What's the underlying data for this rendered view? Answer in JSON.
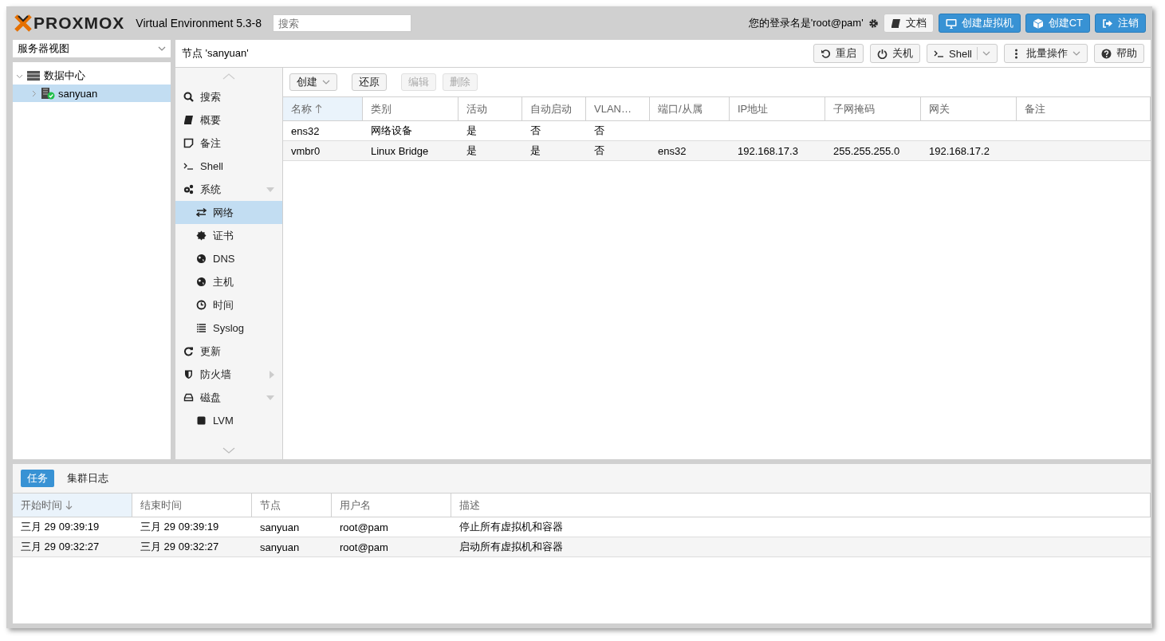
{
  "header": {
    "logo": "PROXMOX",
    "product": "Virtual Environment 5.3-8",
    "search": {
      "placeholder": "搜索"
    },
    "login": "您的登录名是'root@pam'",
    "buttons": [
      {
        "kind": "docs",
        "label": "文档",
        "primary": false
      },
      {
        "kind": "vm",
        "label": "创建虚拟机",
        "primary": true
      },
      {
        "kind": "ct",
        "label": "创建CT",
        "primary": true
      },
      {
        "kind": "logout",
        "label": "注销",
        "primary": true
      }
    ]
  },
  "sidebar": {
    "view": "服务器视图",
    "tree": [
      {
        "label": "数据中心",
        "kind": "datacenter",
        "expanded": true,
        "selected": false,
        "children": [
          {
            "label": "sanyuan",
            "kind": "node",
            "expanded": false,
            "selected": true
          }
        ]
      }
    ]
  },
  "panel": {
    "title": "节点 'sanyuan'",
    "buttons": [
      {
        "kind": "reload",
        "label": "重启",
        "menu": false
      },
      {
        "kind": "power",
        "label": "关机",
        "menu": false
      },
      {
        "kind": "shell",
        "label": "Shell",
        "menu": true
      },
      {
        "kind": "bulk",
        "label": "批量操作",
        "menu": true
      },
      {
        "kind": "help",
        "label": "帮助",
        "menu": false
      }
    ]
  },
  "nav": [
    {
      "kind": "search",
      "label": "搜索",
      "selected": false
    },
    {
      "kind": "summary",
      "label": "概要",
      "selected": false
    },
    {
      "kind": "notes",
      "label": "备注",
      "selected": false
    },
    {
      "kind": "shell",
      "label": "Shell",
      "selected": false
    },
    {
      "kind": "system",
      "label": "系统",
      "selected": false,
      "expanded": true,
      "children": [
        {
          "kind": "network",
          "label": "网络",
          "selected": true
        },
        {
          "kind": "cert",
          "label": "证书",
          "selected": false
        },
        {
          "kind": "globe",
          "label": "DNS",
          "selected": false
        },
        {
          "kind": "globe",
          "label": "主机",
          "selected": false
        },
        {
          "kind": "time",
          "label": "时间",
          "selected": false
        },
        {
          "kind": "list",
          "label": "Syslog",
          "selected": false
        }
      ]
    },
    {
      "kind": "updates",
      "label": "更新",
      "selected": false
    },
    {
      "kind": "firewall",
      "label": "防火墙",
      "selected": false,
      "expanded": false
    },
    {
      "kind": "disks",
      "label": "磁盘",
      "selected": false,
      "expanded": true,
      "children": [
        {
          "kind": "lvm",
          "label": "LVM",
          "selected": false
        }
      ]
    }
  ],
  "toolbar": [
    {
      "label": "创建",
      "menu": true,
      "disabled": false
    },
    {
      "label": "还原",
      "menu": false,
      "disabled": false
    },
    {
      "label": "编辑",
      "menu": false,
      "disabled": true
    },
    {
      "label": "删除",
      "menu": false,
      "disabled": true
    }
  ],
  "table": {
    "columns": [
      {
        "label": "名称",
        "sorted": true,
        "descending": false
      },
      {
        "label": "类别",
        "sorted": false
      },
      {
        "label": "活动",
        "sorted": false
      },
      {
        "label": "自动启动",
        "sorted": false
      },
      {
        "label": "VLAN…",
        "sorted": false
      },
      {
        "label": "端口/从属",
        "sorted": false
      },
      {
        "label": "IP地址",
        "sorted": false
      },
      {
        "label": "子网掩码",
        "sorted": false
      },
      {
        "label": "网关",
        "sorted": false
      },
      {
        "label": "备注",
        "sorted": false
      }
    ],
    "rows": [
      [
        "ens32",
        "网络设备",
        "是",
        "否",
        "否",
        "",
        "",
        "",
        "",
        ""
      ],
      [
        "vmbr0",
        "Linux Bridge",
        "是",
        "是",
        "否",
        "ens32",
        "192.168.17.3",
        "255.255.255.0",
        "192.168.17.2",
        ""
      ]
    ]
  },
  "log": {
    "tabs": [
      {
        "label": "任务",
        "selected": true
      },
      {
        "label": "集群日志",
        "selected": false
      }
    ],
    "columns": [
      {
        "label": "开始时间",
        "sorted": true,
        "descending": true
      },
      {
        "label": "结束时间",
        "sorted": false
      },
      {
        "label": "节点",
        "sorted": false
      },
      {
        "label": "用户名",
        "sorted": false
      },
      {
        "label": "描述",
        "sorted": false
      }
    ],
    "rows": [
      [
        "三月 29 09:39:19",
        "三月 29 09:39:19",
        "sanyuan",
        "root@pam",
        "停止所有虚拟机和容器"
      ],
      [
        "三月 29 09:32:27",
        "三月 29 09:32:27",
        "sanyuan",
        "root@pam",
        "启动所有虚拟机和容器"
      ]
    ]
  }
}
